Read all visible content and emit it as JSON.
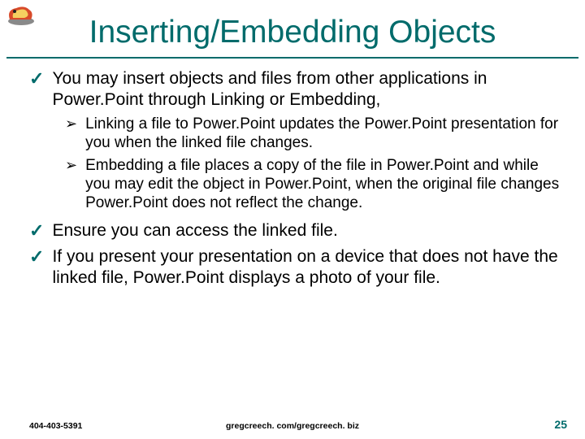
{
  "title": "Inserting/Embedding Objects",
  "bullets": {
    "b1": "You may insert objects and files from other applications in Power.Point through Linking or Embedding,",
    "b1a": "Linking a file to Power.Point updates the Power.Point presentation for you when the linked file changes.",
    "b1b": "Embedding a file places a copy of the file in Power.Point and while you may edit the object in Power.Point, when the original file changes Power.Point does not reflect the change.",
    "b2": "Ensure you can access the linked file.",
    "b3": "If you present your presentation on a device that does not have the linked file, Power.Point displays a photo of your file."
  },
  "marks": {
    "check": "✓",
    "arrow": "➢"
  },
  "footer": {
    "left": "404-403-5391",
    "center": "gregcreech. com/gregcreech. biz",
    "right": "25"
  }
}
